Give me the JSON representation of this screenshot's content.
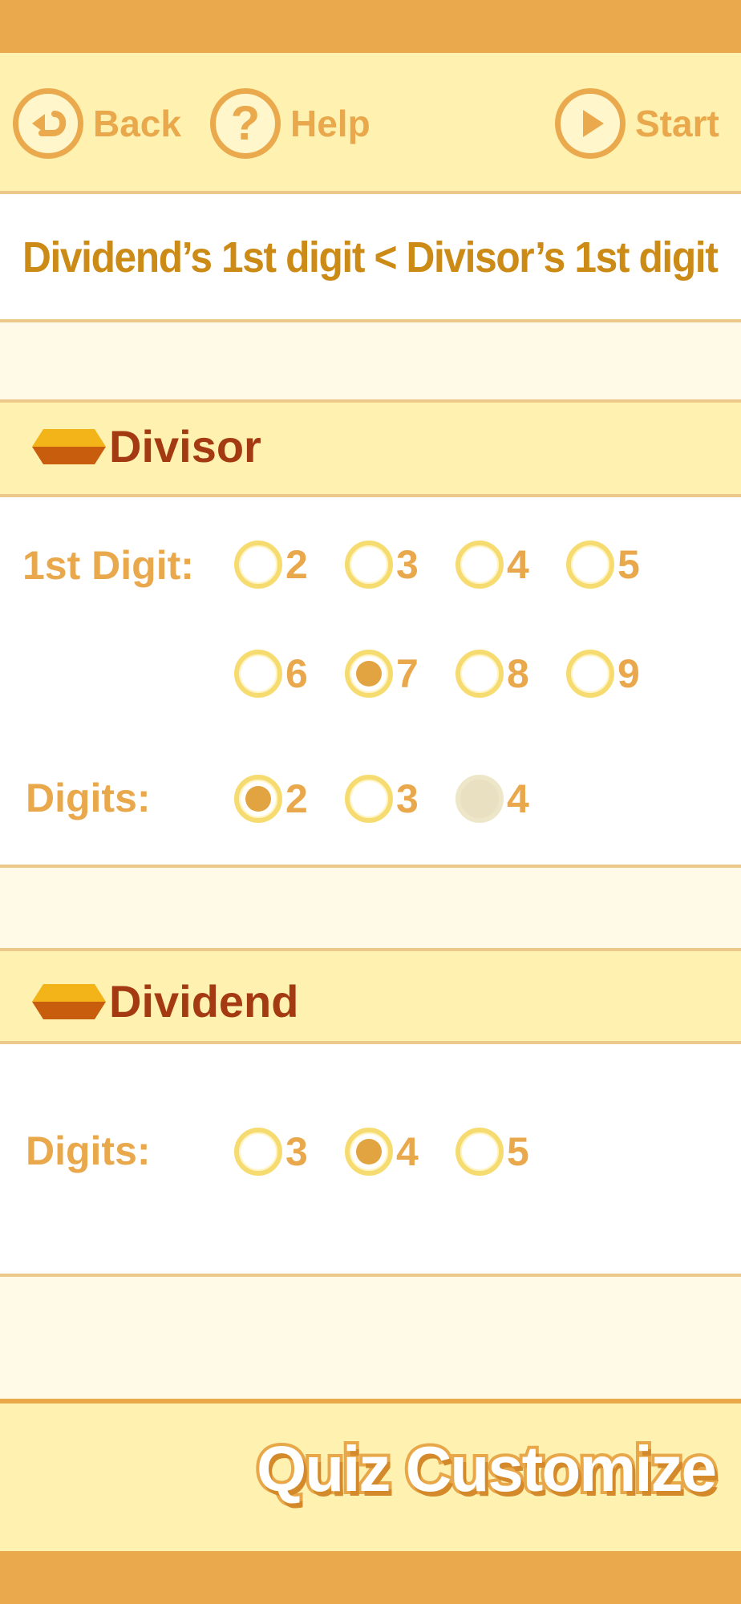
{
  "nav": {
    "back_label": "Back",
    "help_label": "Help",
    "start_label": "Start"
  },
  "title": "Dividend’s 1st digit < Divisor’s 1st digit",
  "divisor": {
    "heading": "Divisor",
    "first_digit_label": "1st Digit:",
    "first_digit_options": [
      "2",
      "3",
      "4",
      "5",
      "6",
      "7",
      "8",
      "9"
    ],
    "first_digit_selected": "7",
    "digits_label": "Digits:",
    "digits_options": [
      "2",
      "3",
      "4"
    ],
    "digits_selected": "2",
    "digits_disabled": [
      "4"
    ]
  },
  "dividend": {
    "heading": "Dividend",
    "digits_label": "Digits:",
    "digits_options": [
      "3",
      "4",
      "5"
    ],
    "digits_selected": "4"
  },
  "footer": {
    "logo_text": "Quiz Customize"
  },
  "colors": {
    "accent": "#eaa94c",
    "text_orange": "#e9a84b",
    "heading_red": "#a43a12",
    "panel_yellow": "#fff1b0"
  }
}
